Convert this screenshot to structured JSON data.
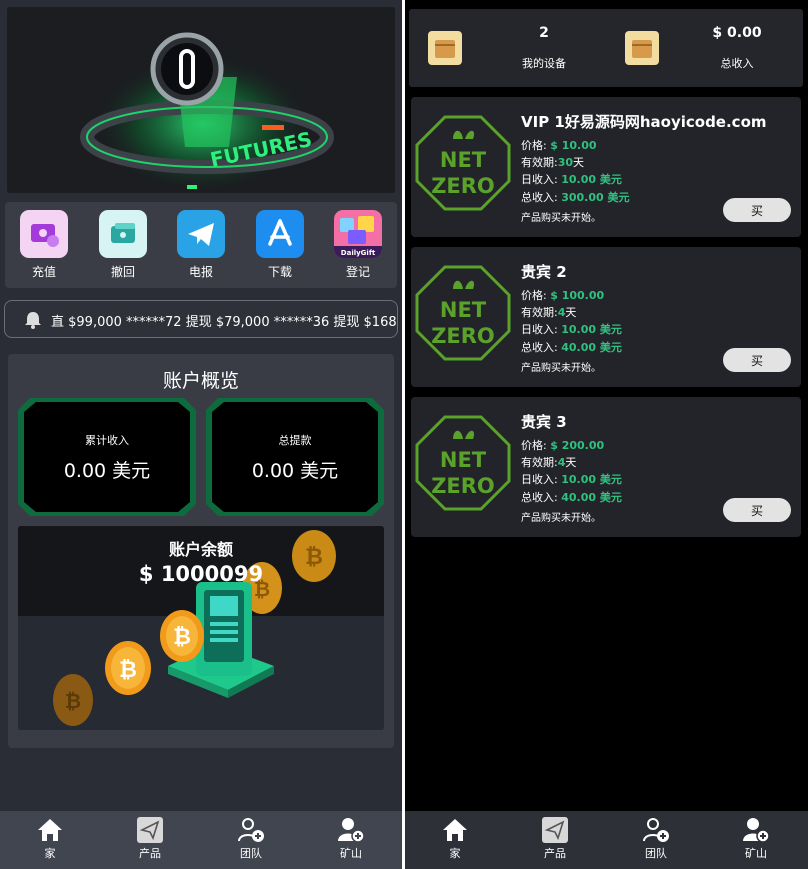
{
  "left": {
    "hero": {
      "logo_text": "FUTURES"
    },
    "quick_actions": [
      {
        "label": "充值",
        "icon": "deposit-icon"
      },
      {
        "label": "撤回",
        "icon": "withdraw-icon"
      },
      {
        "label": "电报",
        "icon": "telegram-icon"
      },
      {
        "label": "下载",
        "icon": "app-store-icon"
      },
      {
        "label": "登记",
        "icon": "daily-gift-icon",
        "badge": "DailyGift"
      }
    ],
    "ticker": {
      "icon": "bell-icon",
      "text": "直 $99,000 ******72 提现 $79,000 ******36 提现 $168,"
    },
    "overview": {
      "title": "账户概览",
      "cumulative_income_label": "累计收入",
      "cumulative_income_value": "0.00 美元",
      "total_withdrawal_label": "总提款",
      "total_withdrawal_value": "0.00 美元",
      "balance_label": "账户余额",
      "balance_value": "$ 1000099"
    }
  },
  "right": {
    "summary": {
      "devices_count": "2",
      "devices_label": "我的设备",
      "total_income_value": "$ 0.00",
      "total_income_label": "总收入"
    },
    "products": [
      {
        "title": "VIP 1好易源码网haoyicode.com",
        "price_label": "价格:",
        "price": "$ 10.00",
        "validity_label": "有效期:",
        "validity_num": "30",
        "validity_unit": "天",
        "daily_label": "日收入:",
        "daily": "10.00 美元",
        "total_label": "总收入:",
        "total": "300.00 美元",
        "note": "产品购买未开始。",
        "buy_label": "买",
        "logo_line1": "NET",
        "logo_line2": "ZERO"
      },
      {
        "title": "贵宾 2",
        "price_label": "价格:",
        "price": "$ 100.00",
        "validity_label": "有效期:",
        "validity_num": "4",
        "validity_unit": "天",
        "daily_label": "日收入:",
        "daily": "10.00 美元",
        "total_label": "总收入:",
        "total": "40.00 美元",
        "note": "产品购买未开始。",
        "buy_label": "买",
        "logo_line1": "NET",
        "logo_line2": "ZERO"
      },
      {
        "title": "贵宾 3",
        "price_label": "价格:",
        "price": "$ 200.00",
        "validity_label": "有效期:",
        "validity_num": "4",
        "validity_unit": "天",
        "daily_label": "日收入:",
        "daily": "10.00 美元",
        "total_label": "总收入:",
        "total": "40.00 美元",
        "note": "产品购买未开始。",
        "buy_label": "买",
        "logo_line1": "NET",
        "logo_line2": "ZERO"
      }
    ]
  },
  "nav": [
    {
      "label": "家",
      "icon": "home-icon"
    },
    {
      "label": "产品",
      "icon": "paper-plane-icon"
    },
    {
      "label": "团队",
      "icon": "add-user-icon"
    },
    {
      "label": "矿山",
      "icon": "add-user-solid-icon"
    }
  ],
  "colors": {
    "accent_green": "#2ec27e",
    "logo_green": "#5aa22a",
    "panel_bg": "#2a2d35"
  }
}
